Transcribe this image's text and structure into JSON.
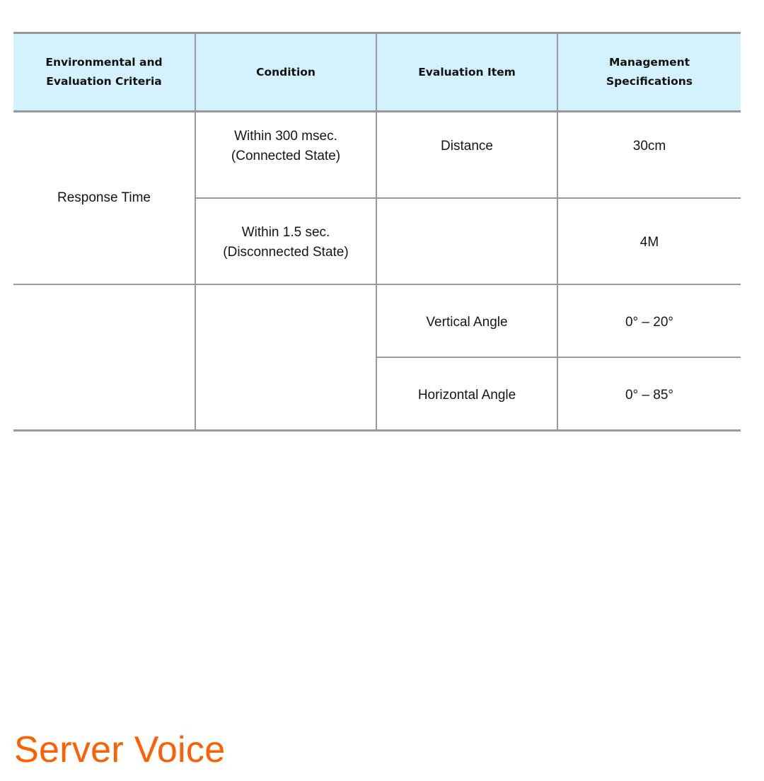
{
  "table": {
    "headers": {
      "criteria": [
        "Environmental and",
        "Evaluation Criteria"
      ],
      "condition": "Condition",
      "evaluation_item": "Evaluation Item",
      "management_specs": [
        "Management",
        "Specifications"
      ]
    },
    "rows": [
      {
        "criteria": "Response Time",
        "condition": [
          "Within 300 msec.",
          "(Connected State)"
        ],
        "evaluation_item": "Distance",
        "specification": "30cm"
      },
      {
        "condition": [
          "Within 1.5 sec.",
          "(Disconnected State)"
        ],
        "evaluation_item": "",
        "specification": "4M"
      },
      {
        "criteria": "",
        "condition": "",
        "evaluation_item": "Vertical Angle",
        "specification": "0° – 20°"
      },
      {
        "evaluation_item": "Horizontal Angle",
        "specification": "0° – 85°"
      }
    ]
  },
  "heading": {
    "title": "Server Voice",
    "color": "#ff5f00"
  },
  "colors": {
    "header_background": "#d4f2fd",
    "border": "#999999"
  }
}
